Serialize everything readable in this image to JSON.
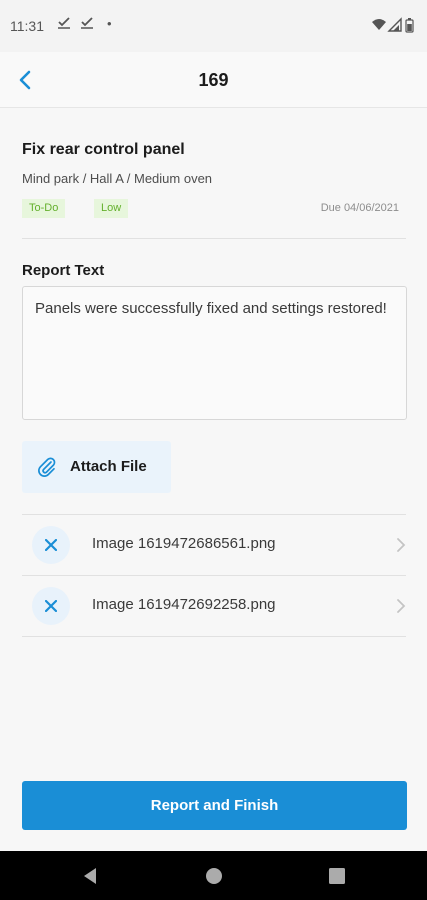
{
  "status_bar": {
    "time": "11:31",
    "indicators": [
      "check-icon",
      "check-icon",
      "dot-icon",
      "wifi-icon",
      "cell-signal-icon",
      "battery-icon"
    ]
  },
  "header": {
    "back_icon": "chevron-left-icon",
    "title": "169"
  },
  "task": {
    "title": "Fix rear control panel",
    "path": "Mind park / Hall A / Medium oven",
    "status_badge": "To-Do",
    "priority_badge": "Low",
    "due": "Due 04/06/2021"
  },
  "report": {
    "label": "Report Text",
    "value": "Panels were successfully fixed and settings restored!"
  },
  "attach": {
    "icon": "paperclip-icon",
    "label": "Attach File"
  },
  "files": [
    {
      "name": "Image 1619472686561.png",
      "remove_icon": "close-icon",
      "open_icon": "chevron-right-icon"
    },
    {
      "name": "Image 1619472692258.png",
      "remove_icon": "close-icon",
      "open_icon": "chevron-right-icon"
    }
  ],
  "footer": {
    "primary_label": "Report and Finish"
  },
  "colors": {
    "accent": "#1a8ed6",
    "badge_bg": "#e7f6dc",
    "badge_text": "#64b02d",
    "attach_bg": "#eaf3fb"
  }
}
